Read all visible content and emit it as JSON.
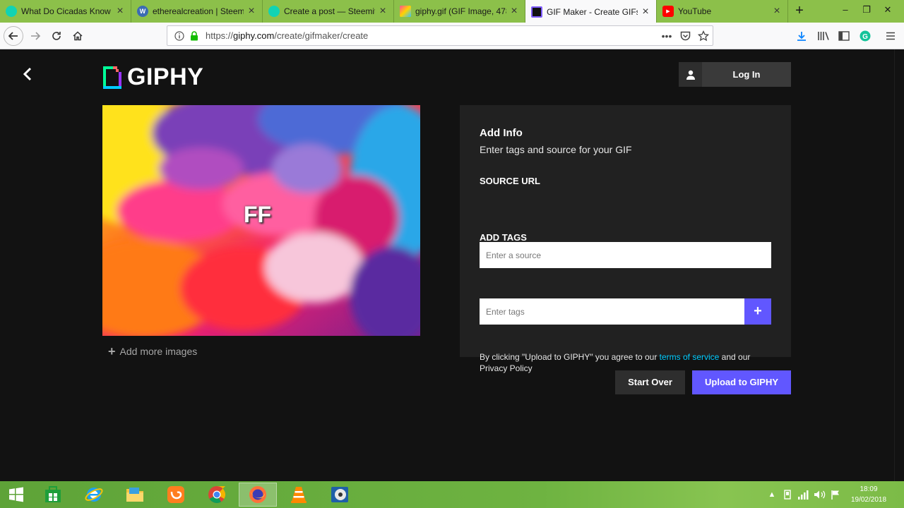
{
  "browser": {
    "tabs": [
      {
        "label": "What Do Cicadas Know Ab",
        "favicon_color": "#11d3b4",
        "favicon_text": "S"
      },
      {
        "label": "etherealcreation | Steem",
        "favicon_color": "#3b6cb3",
        "favicon_text": "W"
      },
      {
        "label": "Create a post — Steemit",
        "favicon_color": "#11d3b4",
        "favicon_text": "S"
      },
      {
        "label": "giphy.gif (GIF Image, 478",
        "favicon_color": "#e04a8f",
        "favicon_text": ""
      },
      {
        "label": "GIF Maker - Create GIFs fro",
        "favicon_color": "#111111",
        "favicon_text": ""
      },
      {
        "label": "YouTube",
        "favicon_color": "#ff0000",
        "favicon_text": "▶"
      }
    ],
    "url_scheme": "https://",
    "url_host": "giphy.com",
    "url_path": "/create/gifmaker/create"
  },
  "page": {
    "logo_text": "GIPHY",
    "login_label": "Log In",
    "preview_overlay_text": "FF",
    "add_more_label": "Add more images",
    "info": {
      "title": "Add Info",
      "subtitle": "Enter tags and source for your GIF",
      "source_label": "SOURCE URL",
      "source_placeholder": "Enter a source",
      "tags_label": "ADD TAGS",
      "tags_placeholder": "Enter tags",
      "terms_prefix": "By clicking \"Upload to GIPHY\" you agree to our ",
      "terms_link": "terms of service",
      "terms_mid": " and our",
      "privacy": "Privacy Policy"
    },
    "start_over_label": "Start Over",
    "upload_label": "Upload to GIPHY"
  },
  "taskbar": {
    "time": "18:09",
    "date": "19/02/2018"
  },
  "colors": {
    "accent": "#6157ff",
    "link": "#00ccff",
    "tabbar": "#8cc04a"
  }
}
